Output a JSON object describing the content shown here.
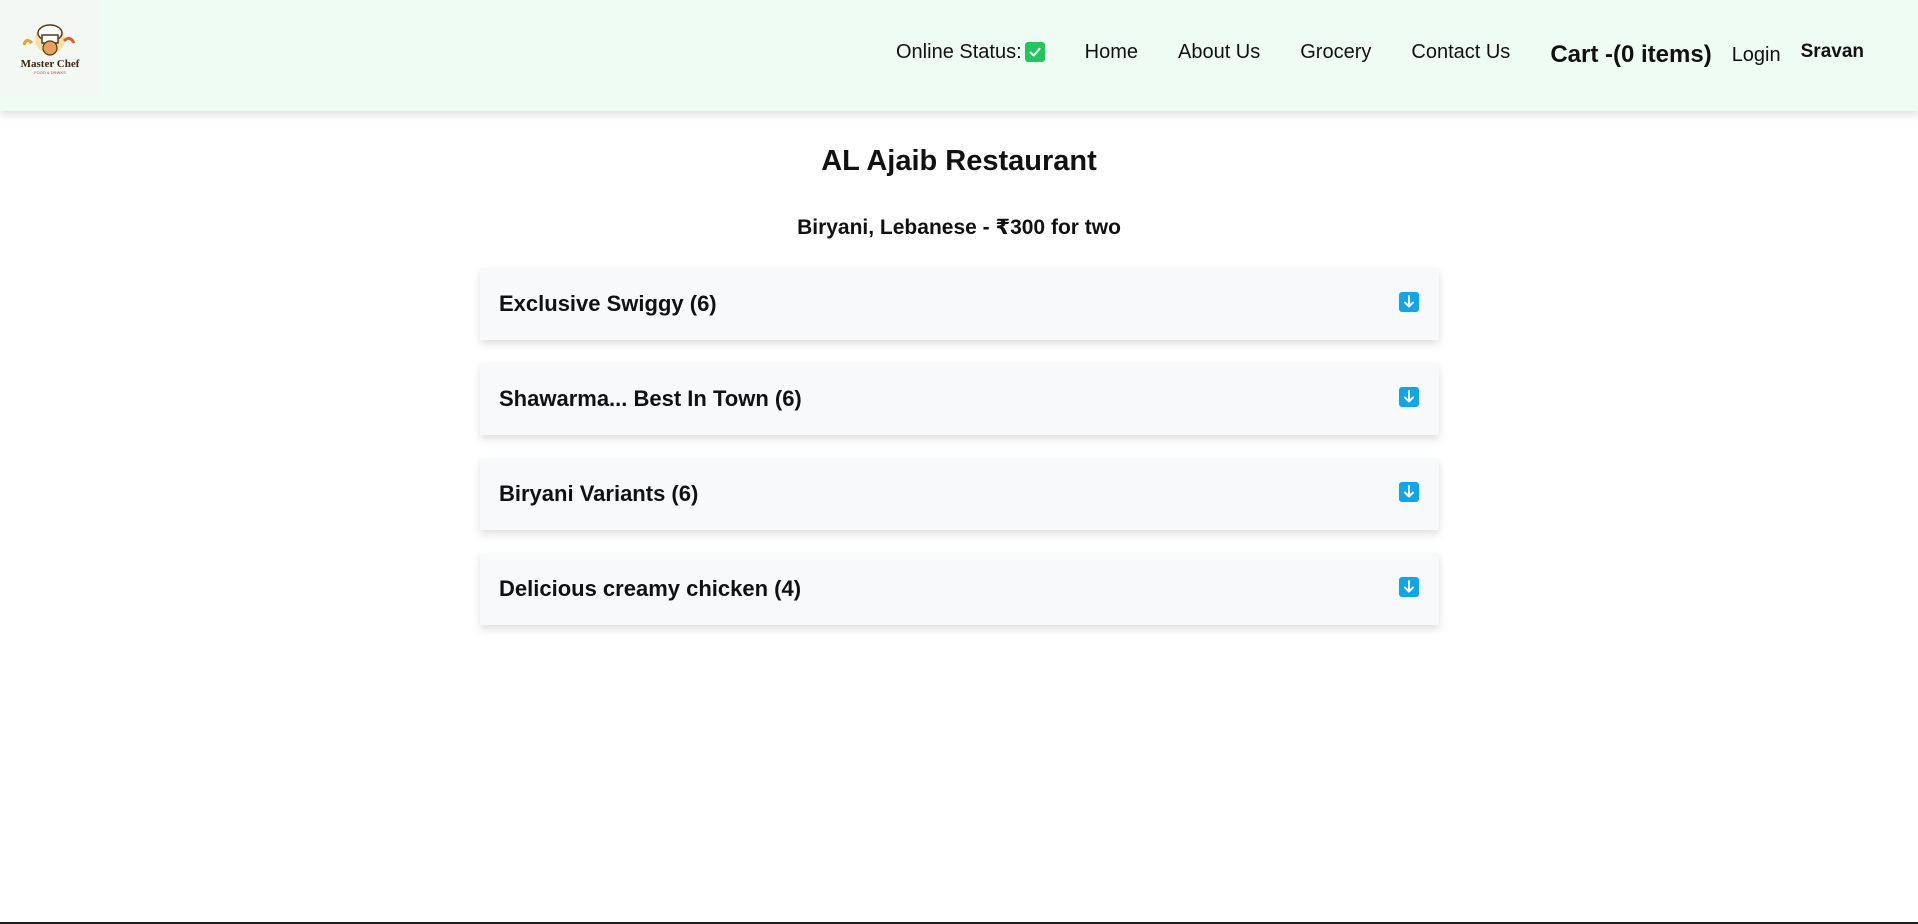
{
  "header": {
    "logo": {
      "text": "Master Chef",
      "subtext": "FOOD & DRINKS",
      "icon": "chef-hat-logo"
    },
    "online_status_label": "Online Status:",
    "online_status_icon": "check-icon",
    "nav": [
      {
        "label": "Home"
      },
      {
        "label": "About Us"
      },
      {
        "label": "Grocery"
      },
      {
        "label": "Contact Us"
      }
    ],
    "cart_label": "Cart -(0 items)",
    "login_label": "Login",
    "user_name": "Sravan"
  },
  "restaurant": {
    "name": "AL Ajaib Restaurant",
    "cuisines_cost": "Biryani, Lebanese - ₹300 for two"
  },
  "categories": [
    {
      "title": "Exclusive Swiggy (6)",
      "icon": "arrow-down-icon"
    },
    {
      "title": "Shawarma... Best In Town (6)",
      "icon": "arrow-down-icon"
    },
    {
      "title": "Biryani Variants (6)",
      "icon": "arrow-down-icon"
    },
    {
      "title": "Delicious creamy chicken (4)",
      "icon": "arrow-down-icon"
    }
  ],
  "colors": {
    "header_bg": "#effcf3",
    "status_check": "#22c55e",
    "accordion_icon": "#0ea5e9",
    "accordion_bg": "#f8f9fa"
  }
}
